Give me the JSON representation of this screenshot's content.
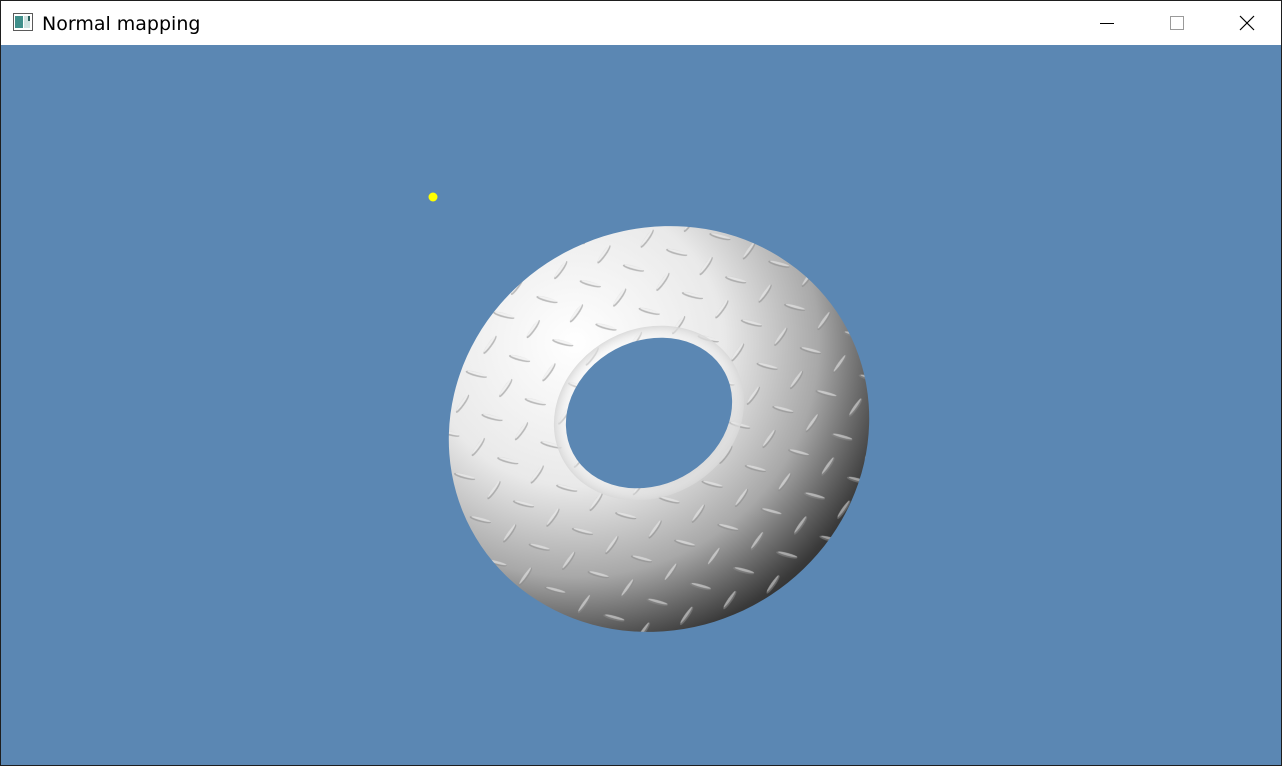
{
  "window": {
    "title": "Normal mapping",
    "icon": "app-icon",
    "controls": [
      "minimize-icon",
      "maximize-icon",
      "close-icon"
    ]
  },
  "scene": {
    "background_color": "#5b87b3",
    "light_color": "#ffff00",
    "object": "torus",
    "object_color": "#ffffff",
    "texture": "diamond-plate"
  }
}
